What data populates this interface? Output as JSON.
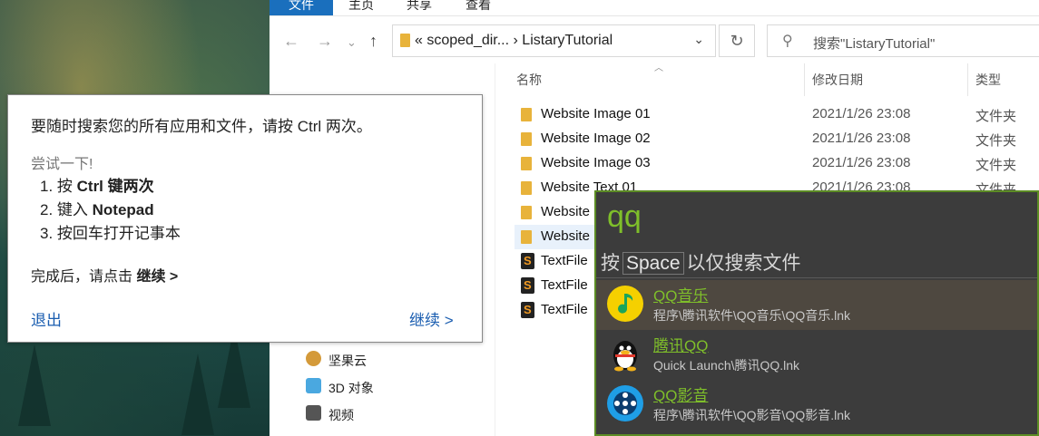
{
  "ribbon": {
    "tabs": [
      "文件",
      "主页",
      "共享",
      "查看"
    ]
  },
  "address": {
    "path": "« scoped_dir... › ListaryTutorial",
    "search_placeholder": "搜索\"ListaryTutorial\""
  },
  "columns": {
    "name": "名称",
    "date": "修改日期",
    "type": "类型"
  },
  "files": [
    {
      "name": "Website Image 01",
      "date": "2021/1/26 23:08",
      "type": "文件夹"
    },
    {
      "name": "Website Image 02",
      "date": "2021/1/26 23:08",
      "type": "文件夹"
    },
    {
      "name": "Website Image 03",
      "date": "2021/1/26 23:08",
      "type": "文件夹"
    },
    {
      "name": "Website Text 01",
      "date": "2021/1/26 23:08",
      "type": "文件夹"
    },
    {
      "name": "Website",
      "date": "",
      "type": ""
    },
    {
      "name": "Website",
      "date": "",
      "type": ""
    },
    {
      "name": "TextFile",
      "date": "",
      "type": ""
    },
    {
      "name": "TextFile",
      "date": "",
      "type": ""
    },
    {
      "name": "TextFile",
      "date": "",
      "type": ""
    }
  ],
  "nav": {
    "items": [
      "坚果云",
      "3D 对象",
      "视频"
    ]
  },
  "tip": {
    "title": "要随时搜索您的所有应用和文件，请按 Ctrl 两次。",
    "try": "尝试一下!",
    "step1_pre": "1. 按 ",
    "step1_bold": "Ctrl 键两次",
    "step2_pre": "2. 键入 ",
    "step2_bold": "Notepad",
    "step3": "3. 按回车打开记事本",
    "done_pre": "完成后，请点击 ",
    "done_bold": "继续 >",
    "exit": "退出",
    "continue": "继续 >"
  },
  "listary": {
    "query": "qq",
    "hint_pre": "按",
    "hint_key": "Space",
    "hint_post": "以仅搜索文件",
    "results": [
      {
        "title": "QQ音乐",
        "path": "程序\\腾讯软件\\QQ音乐\\QQ音乐.lnk",
        "icon": "qq-music-icon",
        "selected": true
      },
      {
        "title": "腾讯QQ",
        "path": "Quick Launch\\腾讯QQ.lnk",
        "icon": "qq-penguin-icon",
        "selected": false
      },
      {
        "title": "QQ影音",
        "path": "程序\\腾讯软件\\QQ影音\\QQ影音.lnk",
        "icon": "qq-player-icon",
        "selected": false
      }
    ]
  },
  "colors": {
    "accent_green": "#7fbf2a",
    "file_tab_blue": "#1a6fbd",
    "link_blue": "#1a5db0"
  }
}
